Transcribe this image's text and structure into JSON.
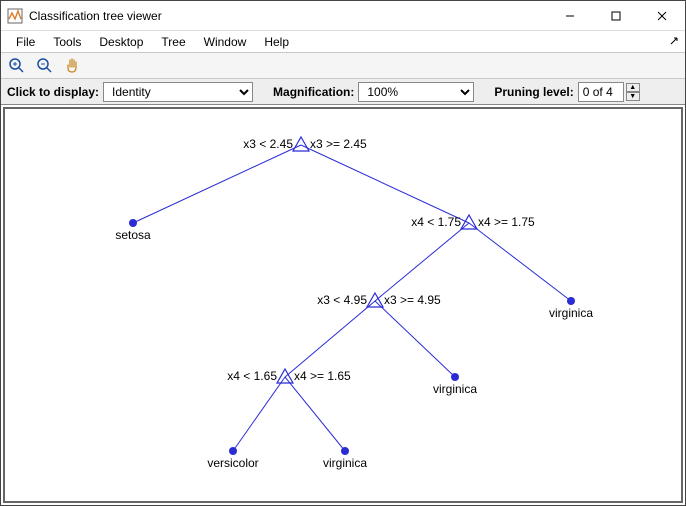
{
  "window": {
    "title": "Classification tree viewer"
  },
  "menus": {
    "file": "File",
    "tools": "Tools",
    "desktop": "Desktop",
    "tree": "Tree",
    "window": "Window",
    "help": "Help"
  },
  "controls": {
    "display_label": "Click to display:",
    "display_value": "Identity",
    "mag_label": "Magnification:",
    "mag_value": "100%",
    "pruning_label": "Pruning level:",
    "pruning_value": "0 of 4"
  },
  "tree": {
    "n0": {
      "left": "x3 < 2.45",
      "right": "x3 >= 2.45"
    },
    "n1": {
      "leaf": "setosa"
    },
    "n2": {
      "left": "x4 < 1.75",
      "right": "x4 >= 1.75"
    },
    "n3": {
      "left": "x3 < 4.95",
      "right": "x3 >= 4.95"
    },
    "n4": {
      "leaf": "virginica"
    },
    "n5": {
      "left": "x4 < 1.65",
      "right": "x4 >= 1.65"
    },
    "n6": {
      "leaf": "virginica"
    },
    "n7": {
      "leaf": "versicolor"
    },
    "n8": {
      "leaf": "virginica"
    }
  }
}
